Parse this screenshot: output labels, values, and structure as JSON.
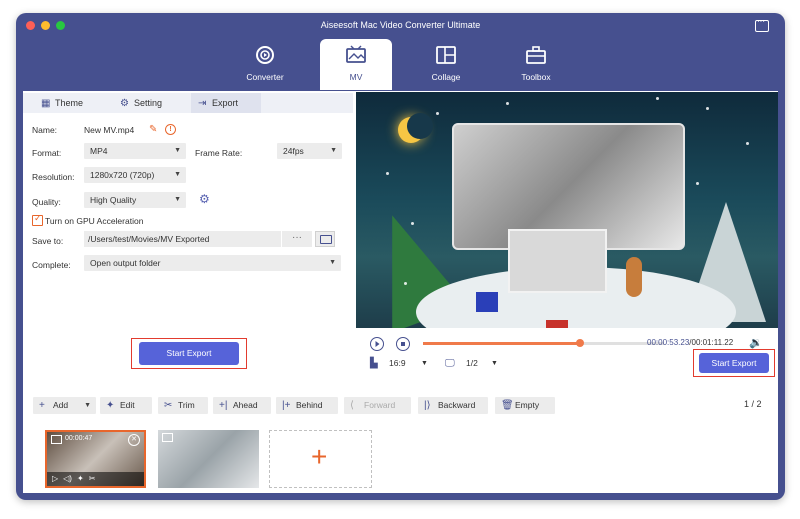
{
  "app": {
    "title": "Aiseesoft Mac Video Converter Ultimate"
  },
  "nav": {
    "tabs": [
      {
        "label": "Converter",
        "icon": "converter-icon"
      },
      {
        "label": "MV",
        "icon": "mv-icon",
        "active": true
      },
      {
        "label": "Collage",
        "icon": "collage-icon"
      },
      {
        "label": "Toolbox",
        "icon": "toolbox-icon"
      }
    ]
  },
  "panel_tabs": {
    "theme": "Theme",
    "setting": "Setting",
    "export": "Export"
  },
  "export": {
    "name_label": "Name:",
    "name_value": "New MV.mp4",
    "format_label": "Format:",
    "format_value": "MP4",
    "frame_rate_label": "Frame Rate:",
    "frame_rate_value": "24fps",
    "resolution_label": "Resolution:",
    "resolution_value": "1280x720 (720p)",
    "quality_label": "Quality:",
    "quality_value": "High Quality",
    "gpu_label": "Turn on GPU Acceleration",
    "gpu_checked": true,
    "save_to_label": "Save to:",
    "save_to_value": "/Users/test/Movies/MV Exported",
    "more_label": "···",
    "complete_label": "Complete:",
    "complete_value": "Open output folder",
    "start_export": "Start Export"
  },
  "player": {
    "current_time": "00:00:53.23",
    "total_time": "/00:01:11.22",
    "progress": 0.65,
    "aspect": "16:9",
    "screen": "1/2",
    "start_export": "Start Export"
  },
  "toolbar": {
    "add": "Add",
    "edit": "Edit",
    "trim": "Trim",
    "ahead": "Ahead",
    "behind": "Behind",
    "forward": "Forward",
    "backward": "Backward",
    "empty": "Empty",
    "page": "1 / 2"
  },
  "clips": [
    {
      "time": "00:00:47",
      "selected": true
    }
  ],
  "colors": {
    "brand": "#46508f",
    "accent": "#e8662c",
    "button": "#5663d9",
    "highlight": "#e23b2e"
  }
}
